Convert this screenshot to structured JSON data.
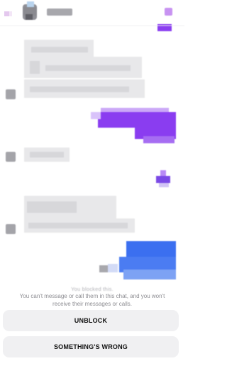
{
  "status": {
    "blocked_label": "You blocked this.",
    "info": "You can't message or call them in this chat, and you won't receive their messages or calls."
  },
  "actions": {
    "unblock_label": "UNBLOCK",
    "wrong_label": "SOMETHING'S WRONG"
  },
  "colors": {
    "outgoing_purple": "#8a3df0",
    "outgoing_blue": "#3b6ff0",
    "incoming_gray": "#e9e9eb",
    "button_bg": "#f0f0f2"
  },
  "icons": {
    "back": "chevron-left-icon",
    "header_action": "square-icon"
  }
}
